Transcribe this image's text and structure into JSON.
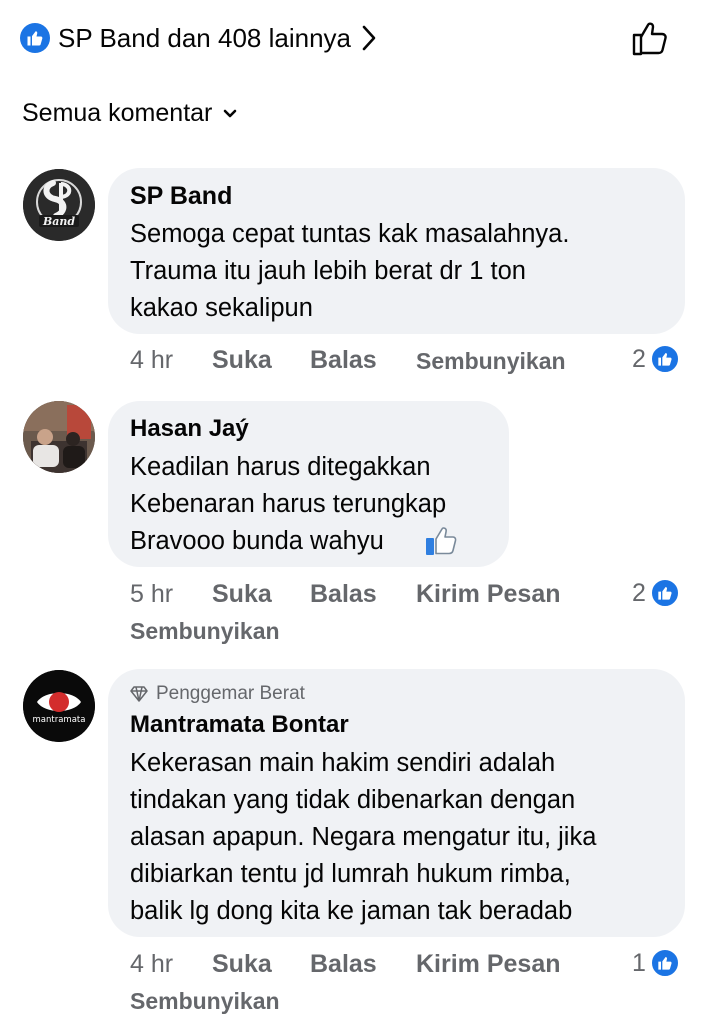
{
  "header": {
    "reactions_text": "SP Band dan 408 lainnya",
    "reaction_icon": "like-icon",
    "like_button_icon": "thumbs-up-outline-icon"
  },
  "filter": {
    "label": "Semua komentar",
    "icon": "chevron-down-icon"
  },
  "colors": {
    "accent": "#1b74e4",
    "bubble": "#f0f2f5",
    "secondary_text": "#65676b"
  },
  "comments": [
    {
      "author": "SP Band",
      "avatar": "SP Band logo",
      "lines": [
        "Semoga cepat tuntas kak masalahnya.",
        "Trauma itu jauh lebih berat dr 1 ton",
        "kakao sekalipun"
      ],
      "time": "4 hr",
      "like": "Suka",
      "reply": "Balas",
      "hide": "Sembunyikan",
      "reactions": "2"
    },
    {
      "author": "Hasan Jaý",
      "lines": [
        "Keadilan harus ditegakkan",
        "Kebenaran harus terungkap",
        "Bravooo bunda wahyu"
      ],
      "emoji_icon": "thumbs-up-emoji-icon",
      "time": "5 hr",
      "like": "Suka",
      "reply": "Balas",
      "message": "Kirim Pesan",
      "hide": "Sembunyikan",
      "reactions": "2"
    },
    {
      "badge": "Penggemar Berat",
      "badge_icon": "diamond-icon",
      "author": "Mantramata Bontar",
      "avatar_text": "mantramata",
      "lines": [
        "Kekerasan main hakim sendiri adalah",
        "tindakan yang tidak dibenarkan dengan",
        "alasan apapun. Negara mengatur itu, jika",
        "dibiarkan tentu jd lumrah hukum rimba,",
        "balik lg dong kita ke jaman tak beradab"
      ],
      "time": "4 hr",
      "like": "Suka",
      "reply": "Balas",
      "message": "Kirim Pesan",
      "hide": "Sembunyikan",
      "reactions": "1"
    }
  ]
}
